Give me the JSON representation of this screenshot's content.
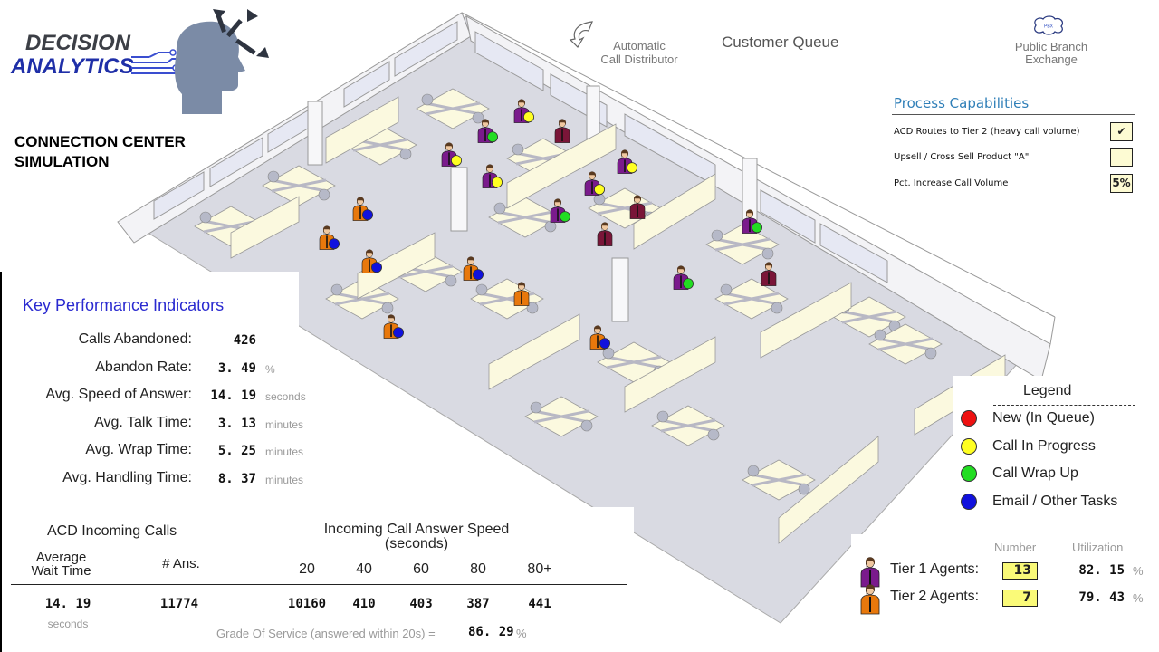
{
  "branding": {
    "logo_line1": "DECISION",
    "logo_line2": "ANALYTICS",
    "app_title_line1": "CONNECTION CENTER",
    "app_title_line2": "SIMULATION"
  },
  "floor_labels": {
    "acd_line1": "Automatic",
    "acd_line2": "Call Distributor",
    "customer_queue": "Customer Queue",
    "pbx_icon_text": "PBX",
    "pbx_line1": "Public Branch",
    "pbx_line2": "Exchange"
  },
  "process_capabilities": {
    "title": "Process Capabilities",
    "items": [
      {
        "label": "ACD Routes to Tier 2 (heavy call volume)",
        "type": "checkbox",
        "checked": true,
        "display": "✔"
      },
      {
        "label": "Upsell / Cross Sell Product \"A\"",
        "type": "checkbox",
        "checked": false,
        "display": ""
      },
      {
        "label": "Pct. Increase Call Volume",
        "type": "input",
        "value": "5%"
      }
    ]
  },
  "kpi": {
    "title": "Key Performance Indicators",
    "rows": [
      {
        "label": "Calls Abandoned:",
        "value": "426",
        "unit": ""
      },
      {
        "label": "Abandon Rate:",
        "value": "3. 49",
        "unit": "%"
      },
      {
        "label": "Avg. Speed of Answer:",
        "value": "14. 19",
        "unit": "seconds"
      },
      {
        "label": "Avg. Talk Time:",
        "value": "3. 13",
        "unit": "minutes"
      },
      {
        "label": "Avg. Wrap Time:",
        "value": "5. 25",
        "unit": "minutes"
      },
      {
        "label": "Avg. Handling Time:",
        "value": "8. 37",
        "unit": "minutes"
      }
    ]
  },
  "acd_incoming": {
    "title": "ACD Incoming Calls",
    "avg_wait_header_line1": "Average",
    "avg_wait_header_line2": "Wait Time",
    "answered_header": "# Ans.",
    "avg_wait_value": "14. 19",
    "avg_wait_unit": "seconds",
    "answered_value": "11774"
  },
  "answer_speed": {
    "title_line1": "Incoming Call Answer Speed",
    "title_line2": "(seconds)",
    "buckets": [
      {
        "label": "20",
        "value": "10160"
      },
      {
        "label": "40",
        "value": "410"
      },
      {
        "label": "60",
        "value": "403"
      },
      {
        "label": "80",
        "value": "387"
      },
      {
        "label": "80+",
        "value": "441"
      }
    ],
    "grade_of_service_label": "Grade Of Service (answered within 20s) =",
    "grade_of_service_value": "86. 29",
    "grade_of_service_unit": "%"
  },
  "legend": {
    "title": "Legend",
    "items": [
      {
        "label": "New (In Queue)",
        "color": "#ee1111"
      },
      {
        "label": "Call In Progress",
        "color": "#ffff22"
      },
      {
        "label": "Call Wrap Up",
        "color": "#22dd22"
      },
      {
        "label": "Email / Other Tasks",
        "color": "#1111dd"
      }
    ]
  },
  "agents": {
    "number_header": "Number",
    "utilization_header": "Utilization",
    "tiers": [
      {
        "label": "Tier 1 Agents:",
        "number": "13",
        "utilization": "82. 15",
        "unit": "%",
        "color": "#7a1a8c"
      },
      {
        "label": "Tier 2 Agents:",
        "number": "7",
        "utilization": "79. 43",
        "unit": "%",
        "color": "#e8780c"
      }
    ]
  },
  "floor_agents": [
    {
      "tier": 1,
      "status": "Call In Progress"
    },
    {
      "tier": 1,
      "status": "Call Wrap Up"
    },
    {
      "tier": 1,
      "status": "idle"
    },
    {
      "tier": 1,
      "status": "Call In Progress"
    },
    {
      "tier": 1,
      "status": "Call In Progress"
    },
    {
      "tier": 1,
      "status": "Call In Progress"
    },
    {
      "tier": 1,
      "status": "Call In Progress"
    },
    {
      "tier": 1,
      "status": "Call Wrap Up"
    },
    {
      "tier": 1,
      "status": "idle"
    },
    {
      "tier": 1,
      "status": "idle"
    },
    {
      "tier": 1,
      "status": "Call Wrap Up"
    },
    {
      "tier": 1,
      "status": "idle"
    },
    {
      "tier": 1,
      "status": "Call Wrap Up"
    },
    {
      "tier": 2,
      "status": "Email / Other Tasks"
    },
    {
      "tier": 2,
      "status": "Email / Other Tasks"
    },
    {
      "tier": 2,
      "status": "Email / Other Tasks"
    },
    {
      "tier": 2,
      "status": "Email / Other Tasks"
    },
    {
      "tier": 2,
      "status": "idle"
    },
    {
      "tier": 2,
      "status": "Email / Other Tasks"
    },
    {
      "tier": 2,
      "status": "Email / Other Tasks"
    }
  ]
}
